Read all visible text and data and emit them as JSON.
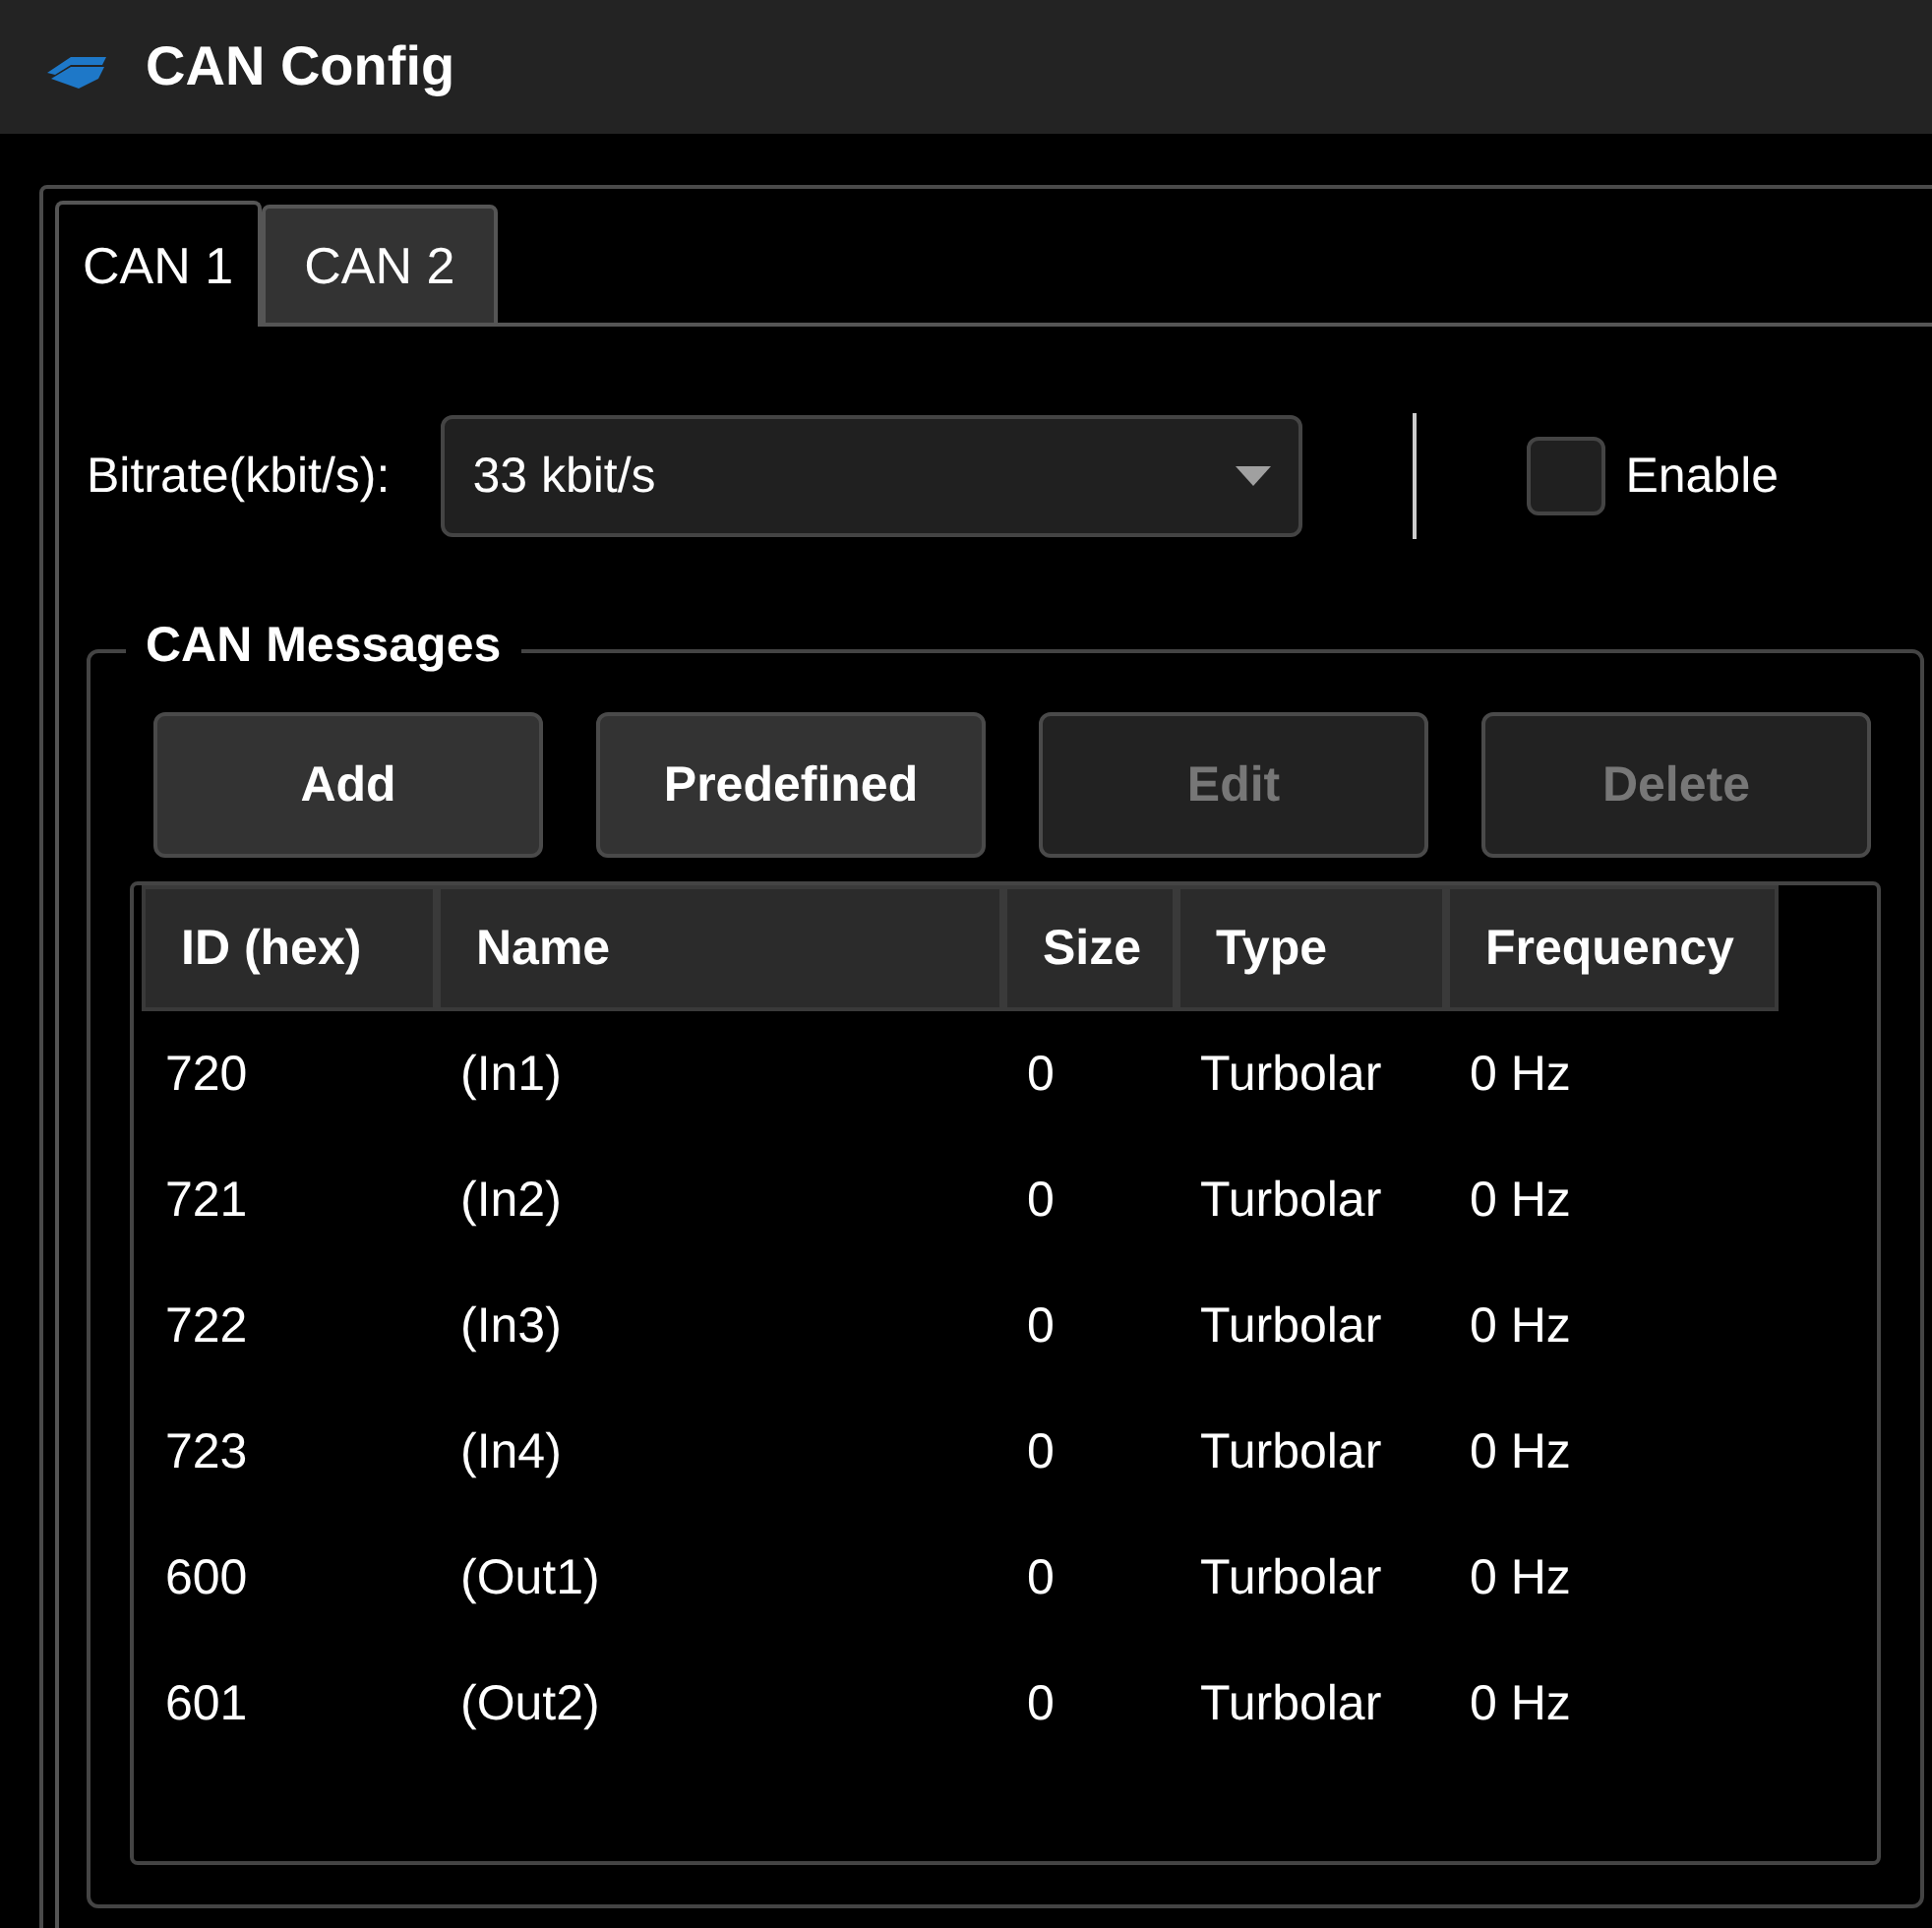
{
  "window": {
    "title": "CAN Config"
  },
  "tabs": [
    {
      "label": "CAN 1",
      "selected": true
    },
    {
      "label": "CAN 2",
      "selected": false
    }
  ],
  "bitrate": {
    "label": "Bitrate(kbit/s):",
    "value": "33 kbit/s"
  },
  "enable": {
    "label": "Enable",
    "checked": false
  },
  "messages": {
    "title": "CAN Messages",
    "buttons": [
      {
        "label": "Add",
        "disabled": false
      },
      {
        "label": "Predefined",
        "disabled": false
      },
      {
        "label": "Edit",
        "disabled": true
      },
      {
        "label": "Delete",
        "disabled": true
      }
    ],
    "table": {
      "columns": [
        "ID (hex)",
        "Name",
        "Size",
        "Type",
        "Frequency"
      ],
      "rows": [
        [
          "720",
          "(In1)",
          "0",
          "Turbolar",
          "0 Hz"
        ],
        [
          "721",
          "(In2)",
          "0",
          "Turbolar",
          "0 Hz"
        ],
        [
          "722",
          "(In3)",
          "0",
          "Turbolar",
          "0 Hz"
        ],
        [
          "723",
          "(In4)",
          "0",
          "Turbolar",
          "0 Hz"
        ],
        [
          "600",
          "(Out1)",
          "0",
          "Turbolar",
          "0 Hz"
        ],
        [
          "601",
          "(Out2)",
          "0",
          "Turbolar",
          "0 Hz"
        ]
      ]
    }
  }
}
